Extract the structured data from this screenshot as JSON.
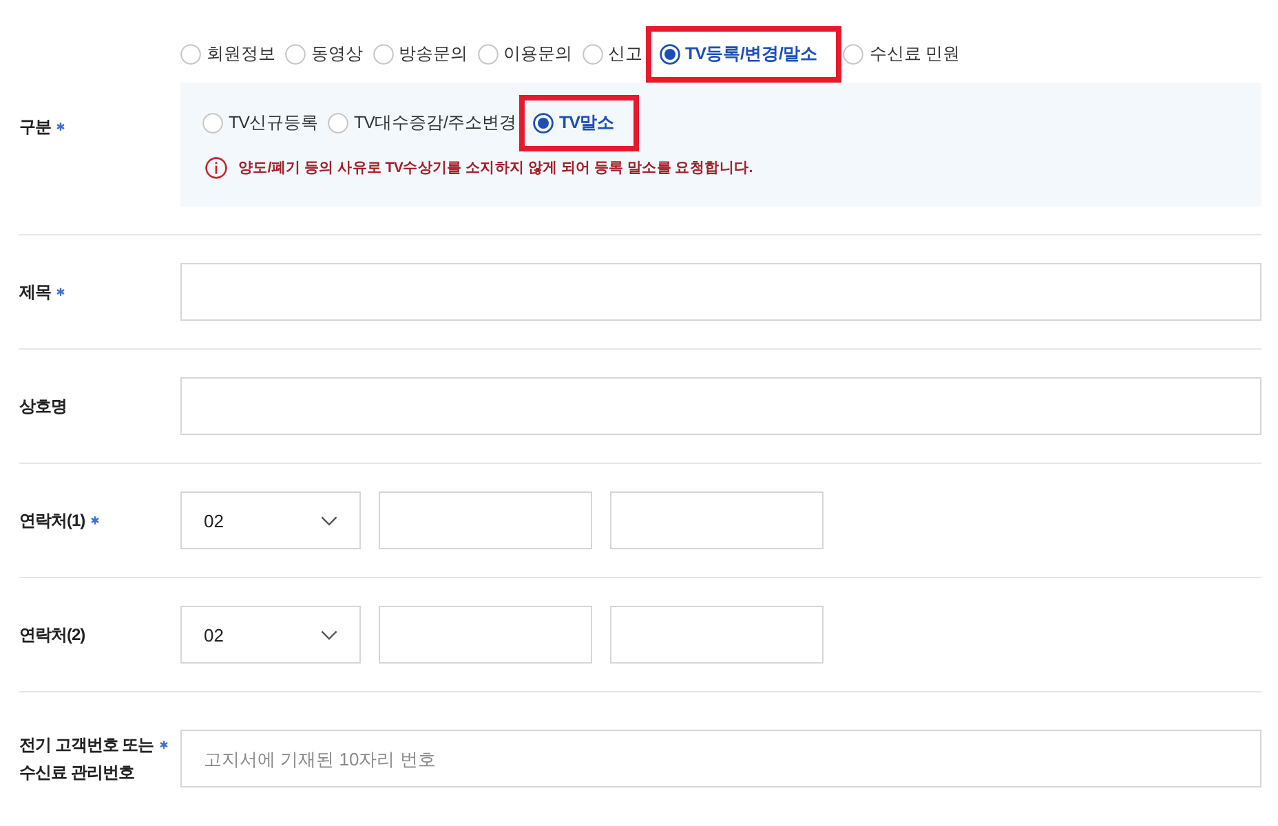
{
  "category": {
    "label": "구분",
    "required": true,
    "options": [
      {
        "label": "회원정보",
        "selected": false,
        "highlighted": false
      },
      {
        "label": "동영상",
        "selected": false,
        "highlighted": false
      },
      {
        "label": "방송문의",
        "selected": false,
        "highlighted": false
      },
      {
        "label": "이용문의",
        "selected": false,
        "highlighted": false
      },
      {
        "label": "신고",
        "selected": false,
        "highlighted": false
      },
      {
        "label": "TV등록/변경/말소",
        "selected": true,
        "highlighted": true
      },
      {
        "label": "수신료 민원",
        "selected": false,
        "highlighted": false
      }
    ],
    "sub_options": [
      {
        "label": "TV신규등록",
        "selected": false,
        "highlighted": false
      },
      {
        "label": "TV대수증감/주소변경",
        "selected": false,
        "highlighted": false
      },
      {
        "label": "TV말소",
        "selected": true,
        "highlighted": true
      }
    ],
    "notice": "양도/폐기 등의 사유로 TV수상기를 소지하지 않게 되어 등록 말소를 요청합니다."
  },
  "fields": [
    {
      "kind": "text",
      "label": "제목",
      "required": true
    },
    {
      "kind": "text",
      "label": "상호명",
      "required": false
    },
    {
      "kind": "phone",
      "label": "연락처(1)",
      "required": true,
      "area_code": "02"
    },
    {
      "kind": "phone",
      "label": "연락처(2)",
      "required": false,
      "area_code": "02"
    },
    {
      "kind": "text",
      "label": "전기 고객번호 또는\n수신료 관리번호",
      "required": true,
      "placeholder": "고지서에 기재된 10자리 번호"
    }
  ]
}
